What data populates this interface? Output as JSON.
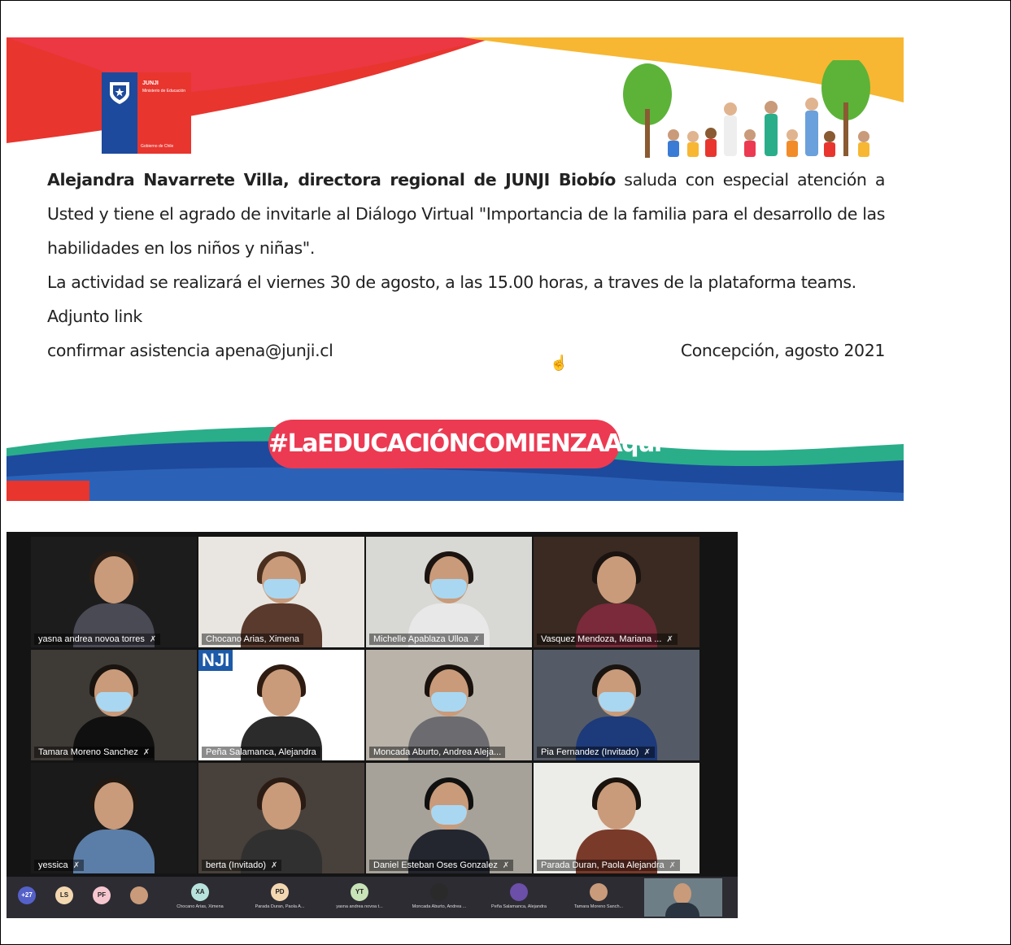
{
  "banner": {
    "logo": {
      "line1": "JUNJI",
      "line2": "Ministerio de Educación",
      "line3": "Gobierno de Chile"
    },
    "sender_bold": "Alejandra Navarrete Villa, directora regional de JUNJI Biobío",
    "paragraph_1_rest": " saluda con especial atención a Usted y tiene el agrado de invitarle al Diálogo Virtual \"Importancia de la familia para el desarrollo de las habilidades en los niños y niñas\".",
    "paragraph_2": "La actividad se realizará el viernes 30 de agosto, a las 15.00 horas, a traves de la plataforma teams.",
    "attachment": "Adjunto link",
    "confirm": "confirmar asistencia apena@junji.cl",
    "place_date": "Concepción, agosto 2021",
    "hashtag": "#LaEDUCACIÓNCOMIENZAAquí",
    "colors": {
      "red": "#e8352e",
      "pink": "#ec3a52",
      "yellow": "#f7b733",
      "green": "#2aae8a",
      "blue": "#1d4a9c"
    }
  },
  "call": {
    "participants": [
      {
        "name": "yasna  andrea novoa torres",
        "muted": true
      },
      {
        "name": "Chocano Arias, Ximena",
        "muted": false
      },
      {
        "name": "Michelle Apablaza Ulloa",
        "muted": true
      },
      {
        "name": "Vasquez Mendoza, Mariana ...",
        "muted": true
      },
      {
        "name": "Tamara Moreno Sanchez",
        "muted": true
      },
      {
        "name": "Peña Salamanca, Alejandra",
        "muted": false
      },
      {
        "name": "Moncada Aburto, Andrea Aleja...",
        "muted": false
      },
      {
        "name": "Pia Fernandez (Invitado)",
        "muted": true
      },
      {
        "name": "yessica",
        "muted": true
      },
      {
        "name": "berta (Invitado)",
        "muted": true
      },
      {
        "name": "Daniel Esteban Oses Gonzalez",
        "muted": true
      },
      {
        "name": "Parada Duran, Paola Alejandra",
        "muted": true
      }
    ],
    "junji_label": "NJI",
    "mic_glyph": "✗",
    "overflow_count": "+27",
    "avatar_initials": [
      "LS",
      "PF"
    ],
    "bottom_slots": [
      {
        "initials": "XA",
        "label": "Chocano Arias, Ximena"
      },
      {
        "initials": "PD",
        "label": "Parada Duran, Paola A..."
      },
      {
        "initials": "YT",
        "label": "yasna andrea novoa t..."
      },
      {
        "initials": "",
        "label": "Moncada Aburto, Andrea ..."
      },
      {
        "initials": "",
        "label": "Peña Salamanca, Alejandra"
      },
      {
        "initials": "",
        "label": "Tamara Moreno Sanch..."
      }
    ]
  }
}
